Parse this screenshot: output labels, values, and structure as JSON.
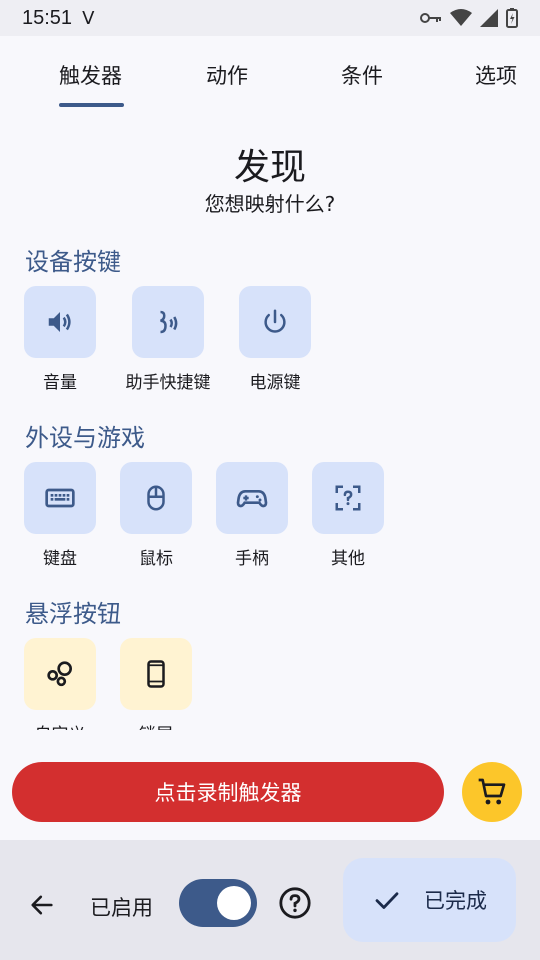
{
  "status": {
    "time": "15:51",
    "carrier_icon": "V"
  },
  "tabs": [
    {
      "label": "触发器",
      "selected": true
    },
    {
      "label": "动作",
      "selected": false
    },
    {
      "label": "条件",
      "selected": false
    },
    {
      "label": "选项",
      "selected": false
    }
  ],
  "header": {
    "title": "发现",
    "subtitle": "您想映射什么?"
  },
  "sections": {
    "device_keys": {
      "title": "设备按键",
      "items": [
        {
          "label": "音量",
          "icon": "volume-icon"
        },
        {
          "label": "助手快捷键",
          "icon": "assistant-icon"
        },
        {
          "label": "电源键",
          "icon": "power-icon"
        }
      ]
    },
    "peripherals": {
      "title": "外设与游戏",
      "items": [
        {
          "label": "键盘",
          "icon": "keyboard-icon"
        },
        {
          "label": "鼠标",
          "icon": "mouse-icon"
        },
        {
          "label": "手柄",
          "icon": "gamepad-icon"
        },
        {
          "label": "其他",
          "icon": "unknown-device-icon"
        }
      ]
    },
    "floating": {
      "title": "悬浮按钮",
      "items": [
        {
          "label": "自定义",
          "icon": "bubbles-icon"
        },
        {
          "label": "锁屏",
          "icon": "phone-icon"
        }
      ]
    }
  },
  "actions": {
    "record_label": "点击录制触发器"
  },
  "bottom": {
    "enabled_label": "已启用",
    "enabled": true,
    "done_label": "已完成"
  },
  "colors": {
    "accent": "#3d5a8a",
    "tile": "#d7e2fa",
    "tile_yellow": "#fff3d2",
    "record": "#d32f2f",
    "cart": "#fcc62a"
  }
}
